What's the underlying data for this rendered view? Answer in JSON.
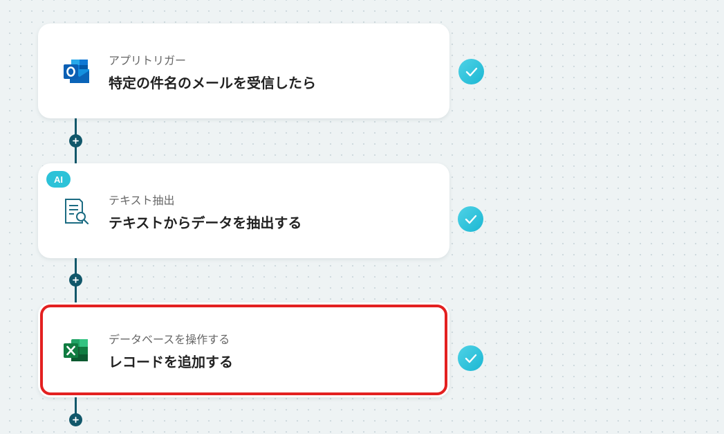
{
  "steps": [
    {
      "subtitle": "アプリトリガー",
      "title": "特定の件名のメールを受信したら",
      "icon": "outlook-icon",
      "completed": true
    },
    {
      "badge": "AI",
      "subtitle": "テキスト抽出",
      "title": "テキストからデータを抽出する",
      "icon": "document-search-icon",
      "completed": true
    },
    {
      "subtitle": "データベースを操作する",
      "title": "レコードを追加する",
      "icon": "excel-icon",
      "completed": true,
      "highlighted": true
    }
  ],
  "colors": {
    "accent": "#2cc2d8",
    "connector": "#11576a",
    "highlight": "#e32020"
  }
}
